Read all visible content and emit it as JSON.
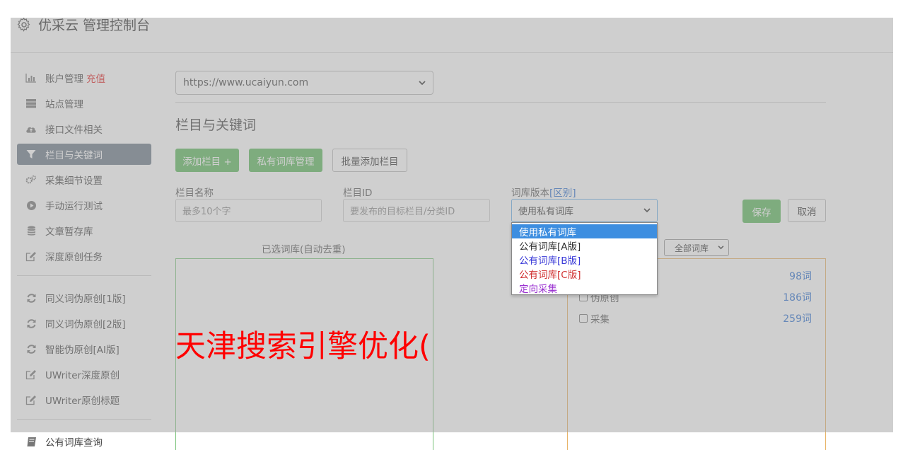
{
  "header": {
    "title": "优采云 管理控制台",
    "icon": "gear-icon"
  },
  "sidebar": {
    "group1": [
      {
        "label": "账户管理",
        "badge": "充值",
        "icon": "bar-chart-icon"
      },
      {
        "label": "站点管理",
        "icon": "server-icon"
      },
      {
        "label": "接口文件相关",
        "icon": "cloud-upload-icon"
      },
      {
        "label": "栏目与关键词",
        "icon": "filter-icon",
        "active": true
      },
      {
        "label": "采集细节设置",
        "icon": "cogs-icon"
      },
      {
        "label": "手动运行测试",
        "icon": "play-circle-icon"
      },
      {
        "label": "文章暂存库",
        "icon": "database-icon"
      },
      {
        "label": "深度原创任务",
        "icon": "edit-icon"
      }
    ],
    "group2": [
      {
        "label": "同义词伪原创[1版]",
        "icon": "refresh-icon"
      },
      {
        "label": "同义词伪原创[2版]",
        "icon": "refresh-icon"
      },
      {
        "label": "智能伪原创[AI版]",
        "icon": "refresh-icon"
      },
      {
        "label": "UWriter深度原创",
        "icon": "edit-icon"
      },
      {
        "label": "UWriter原创标题",
        "icon": "edit-icon"
      }
    ],
    "group3": [
      {
        "label": "公有词库查询",
        "icon": "book-icon"
      }
    ]
  },
  "main": {
    "site_select": {
      "value": "https://www.ucaiyun.com"
    },
    "section_title": "栏目与关键词",
    "buttons": {
      "add_column": "添加栏目 +",
      "private_lib": "私有词库管理",
      "batch_add": "批量添加栏目",
      "save": "保存",
      "cancel": "取消"
    },
    "form": {
      "name_label": "栏目名称",
      "name_placeholder": "最多10个字",
      "id_label": "栏目ID",
      "id_placeholder": "要发布的目标栏目/分类ID",
      "version_label": "词库版本",
      "version_link": "[区别]",
      "version_value": "使用私有词库"
    },
    "dropdown_options": [
      {
        "label": "使用私有词库",
        "selected": true
      },
      {
        "label": "公有词库[A版]"
      },
      {
        "label": "公有词库[B版]"
      },
      {
        "label": "公有词库[C版]"
      },
      {
        "label": "定向采集"
      }
    ],
    "selected_title": "已选词库(自动去重)",
    "filter_value": "全部词库",
    "libraries": [
      {
        "label": "",
        "count": "98词"
      },
      {
        "label": "伪原创",
        "count": "186词"
      },
      {
        "label": "采集",
        "count": "259词"
      }
    ]
  },
  "watermark": "天津搜索引擎优化("
}
